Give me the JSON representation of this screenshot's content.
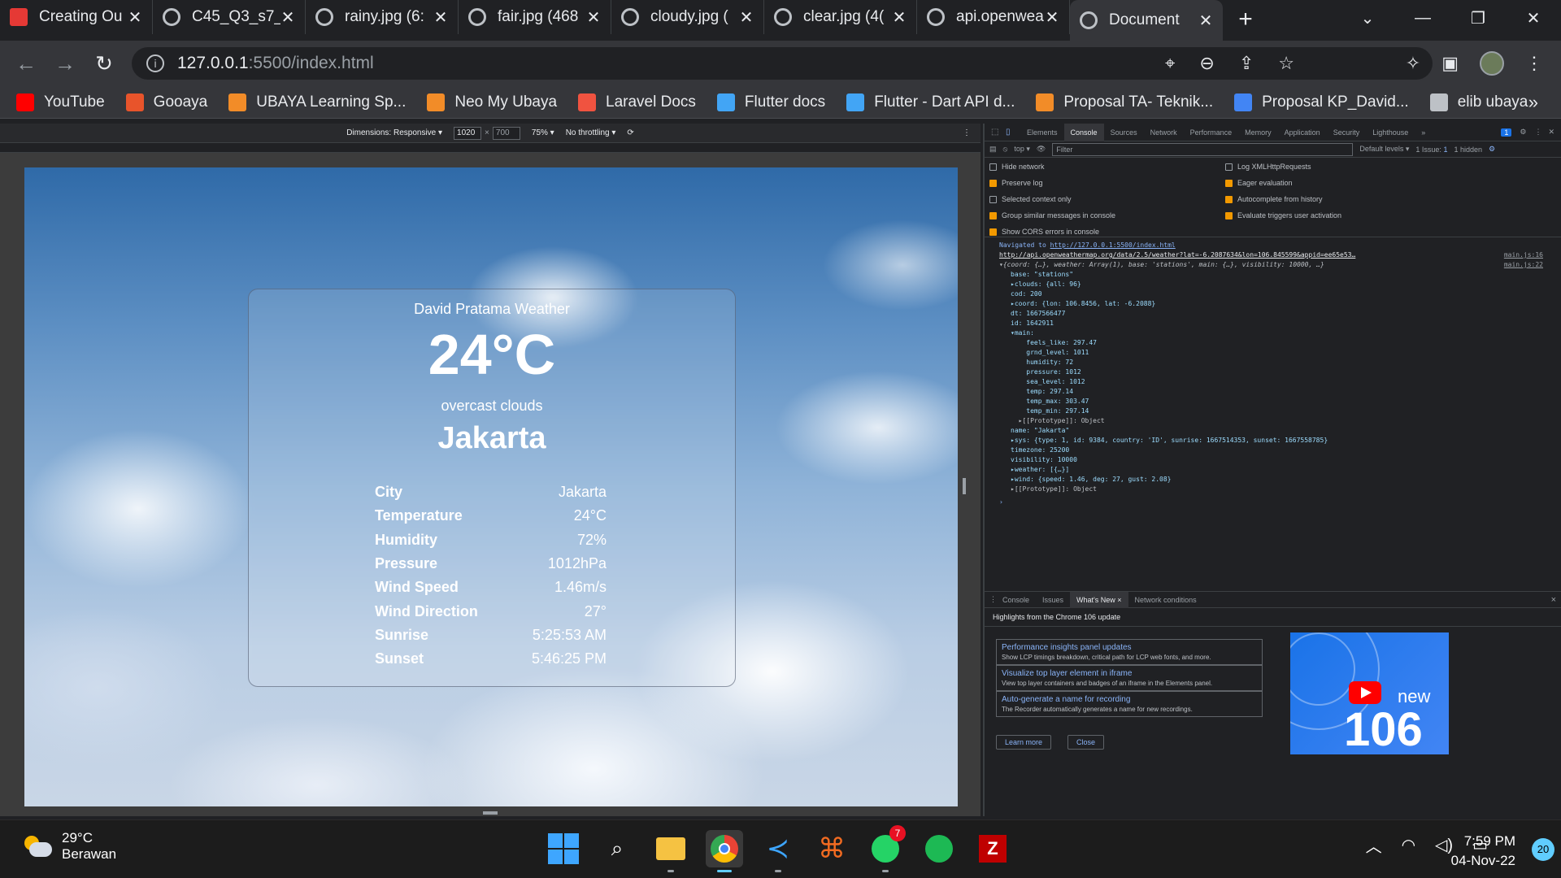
{
  "browser": {
    "tabs": [
      {
        "title": "Creating Ou",
        "active": false
      },
      {
        "title": "C45_Q3_s7_",
        "active": false
      },
      {
        "title": "rainy.jpg (6:",
        "active": false
      },
      {
        "title": "fair.jpg (468",
        "active": false
      },
      {
        "title": "cloudy.jpg (",
        "active": false
      },
      {
        "title": "clear.jpg (4(",
        "active": false
      },
      {
        "title": "api.openwea",
        "active": false
      },
      {
        "title": "Document",
        "active": true
      }
    ],
    "new_tab": "+",
    "url_host": "127.0.0.1",
    "url_path": ":5500/index.html",
    "bookmarks": [
      {
        "label": "YouTube",
        "color": "#ff0000"
      },
      {
        "label": "Gooaya",
        "color": "#e8542b"
      },
      {
        "label": "UBAYA Learning Sp...",
        "color": "#f28c28"
      },
      {
        "label": "Neo My Ubaya",
        "color": "#f28c28"
      },
      {
        "label": "Laravel Docs",
        "color": "#f05340"
      },
      {
        "label": "Flutter docs",
        "color": "#42a5f5"
      },
      {
        "label": "Flutter - Dart API d...",
        "color": "#42a5f5"
      },
      {
        "label": "Proposal TA- Teknik...",
        "color": "#f28c28"
      },
      {
        "label": "Proposal KP_David...",
        "color": "#4285f4"
      },
      {
        "label": "elib ubaya",
        "color": "#bdc1c6"
      }
    ],
    "bookmarks_more": "»"
  },
  "device_toolbar": {
    "dimensions_label": "Dimensions: Responsive ▾",
    "width": "1020",
    "times": "×",
    "height": "700",
    "zoom": "75% ▾",
    "throttling": "No throttling ▾"
  },
  "weather_card": {
    "brand": "David Pratama Weather",
    "temperature": "24°C",
    "description": "overcast clouds",
    "city": "Jakarta",
    "rows": [
      {
        "label": "City",
        "value": "Jakarta"
      },
      {
        "label": "Temperature",
        "value": "24°C"
      },
      {
        "label": "Humidity",
        "value": "72%"
      },
      {
        "label": "Pressure",
        "value": "1012hPa"
      },
      {
        "label": "Wind Speed",
        "value": "1.46m/s"
      },
      {
        "label": "Wind Direction",
        "value": "27°"
      },
      {
        "label": "Sunrise",
        "value": "5:25:53 AM"
      },
      {
        "label": "Sunset",
        "value": "5:46:25 PM"
      }
    ]
  },
  "devtools": {
    "tabs": [
      "Elements",
      "Console",
      "Sources",
      "Network",
      "Performance",
      "Memory",
      "Application",
      "Security",
      "Lighthouse",
      "»"
    ],
    "active_tab": "Console",
    "issue_count": "1",
    "context": "top ▾",
    "filter_placeholder": "Filter",
    "levels": "Default levels ▾",
    "issues_label": "1 Issue: ",
    "issues_badge": "1",
    "hidden": "1 hidden",
    "options_left": [
      {
        "label": "Hide network",
        "checked": false
      },
      {
        "label": "Preserve log",
        "checked": true
      },
      {
        "label": "Selected context only",
        "checked": false
      },
      {
        "label": "Group similar messages in console",
        "checked": true
      },
      {
        "label": "Show CORS errors in console",
        "checked": true
      }
    ],
    "options_right": [
      {
        "label": "Log XMLHttpRequests",
        "checked": false
      },
      {
        "label": "Eager evaluation",
        "checked": true
      },
      {
        "label": "Autocomplete from history",
        "checked": true
      },
      {
        "label": "Evaluate triggers user activation",
        "checked": true
      }
    ],
    "console": {
      "navigated_prefix": "Navigated to ",
      "navigated_url": "http://127.0.0.1:5500/index.html",
      "request_url": "http://api.openweathermap.org/data/2.5/weather?lat=-6.2087634&lon=106.845599&appid=ee65e53…",
      "src1": "main.js:16",
      "src2": "main.js:22",
      "object_summary": "▾{coord: {…}, weather: Array(1), base: 'stations', main: {…}, visibility: 10000, …}",
      "lines": [
        "base: \"stations\"",
        "▸clouds: {all: 96}",
        "cod: 200",
        "▸coord: {lon: 106.8456, lat: -6.2088}",
        "dt: 1667566477",
        "id: 1642911",
        "▾main:",
        "    feels_like: 297.47",
        "    grnd_level: 1011",
        "    humidity: 72",
        "    pressure: 1012",
        "    sea_level: 1012",
        "    temp: 297.14",
        "    temp_max: 303.47",
        "    temp_min: 297.14",
        "  ▸[[Prototype]]: Object",
        "name: \"Jakarta\"",
        "▸sys: {type: 1, id: 9384, country: 'ID', sunrise: 1667514353, sunset: 1667558785}",
        "timezone: 25200",
        "visibility: 10000",
        "▸weather: [{…}]",
        "▸wind: {speed: 1.46, deg: 27, gust: 2.08}",
        "▸[[Prototype]]: Object"
      ],
      "prompt": "›"
    },
    "drawer": {
      "tabs": [
        "Console",
        "Issues",
        "What's New ×",
        "Network conditions"
      ],
      "active": "What's New ×",
      "close": "×",
      "heading": "Highlights from the Chrome 106 update",
      "features": [
        {
          "title": "Performance insights panel updates",
          "desc": "Show LCP timings breakdown, critical path for LCP web fonts, and more."
        },
        {
          "title": "Visualize top layer element in iframe",
          "desc": "View top layer containers and badges of an iframe in the Elements panel."
        },
        {
          "title": "Auto-generate a name for recording",
          "desc": "The Recorder automatically generates a name for new recordings."
        }
      ],
      "learn_more": "Learn more",
      "close_btn": "Close",
      "promo_new": "new",
      "promo_version": "106"
    }
  },
  "taskbar": {
    "weather_temp": "29°C",
    "weather_desc": "Berawan",
    "whatsapp_badge": "7",
    "time": "7:59 PM",
    "date": "04-Nov-22",
    "notifications": "20"
  }
}
